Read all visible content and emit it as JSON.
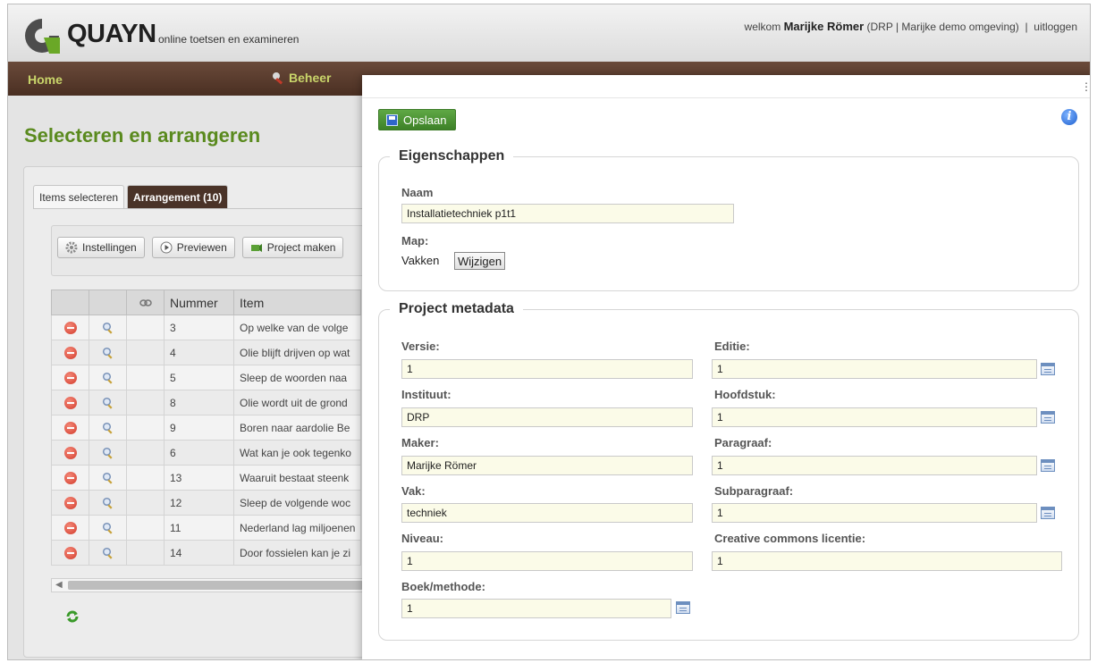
{
  "header": {
    "brand": "QUAYN",
    "tagline": "online toetsen en examineren",
    "welcome_prefix": "welkom",
    "user_name": "Marijke Römer",
    "context": "(DRP | Marijke demo omgeving)",
    "separator": "|",
    "logout": "uitloggen"
  },
  "nav": {
    "home": "Home",
    "beheer": "Beheer"
  },
  "page_title": "Selecteren en arrangeren",
  "tabs": [
    {
      "label": "Items selecteren"
    },
    {
      "label": "Arrangement (10)"
    }
  ],
  "toolbar": {
    "instellingen": "Instellingen",
    "previewen": "Previewen",
    "project_maken": "Project maken"
  },
  "table": {
    "headers": {
      "nummer": "Nummer",
      "item": "Item"
    },
    "rows": [
      {
        "nummer": "3",
        "item": "Op welke van de volge"
      },
      {
        "nummer": "4",
        "item": "Olie blijft drijven op wat"
      },
      {
        "nummer": "5",
        "item": "Sleep de woorden naa"
      },
      {
        "nummer": "8",
        "item": "Olie wordt uit de grond"
      },
      {
        "nummer": "9",
        "item": "Boren naar aardolie Be"
      },
      {
        "nummer": "6",
        "item": "Wat kan je ook tegenko"
      },
      {
        "nummer": "13",
        "item": "Waaruit bestaat steenk"
      },
      {
        "nummer": "12",
        "item": "Sleep de volgende woc"
      },
      {
        "nummer": "11",
        "item": "Nederland lag miljoenen"
      },
      {
        "nummer": "14",
        "item": "Door fossielen kan je zi"
      }
    ]
  },
  "dialog": {
    "save": "Opslaan",
    "eigenschappen": {
      "legend": "Eigenschappen",
      "naam_label": "Naam",
      "naam_value": "Installatietechniek p1t1",
      "map_label": "Map:",
      "map_value": "Vakken",
      "wijzigen": "Wijzigen"
    },
    "metadata": {
      "legend": "Project metadata",
      "versie_label": "Versie:",
      "versie_value": "1",
      "editie_label": "Editie:",
      "editie_value": "1",
      "instituut_label": "Instituut:",
      "instituut_value": "DRP",
      "hoofdstuk_label": "Hoofdstuk:",
      "hoofdstuk_value": "1",
      "maker_label": "Maker:",
      "maker_value": "Marijke Römer",
      "paragraaf_label": "Paragraaf:",
      "paragraaf_value": "1",
      "vak_label": "Vak:",
      "vak_value": "techniek",
      "subparagraaf_label": "Subparagraaf:",
      "subparagraaf_value": "1",
      "niveau_label": "Niveau:",
      "niveau_value": "1",
      "cc_label": "Creative commons licentie:",
      "cc_value": "1",
      "boek_label": "Boek/methode:",
      "boek_value": "1"
    }
  },
  "colors": {
    "brand_green": "#5a8a1e",
    "nav_brown": "#4a2f22",
    "nav_text": "#c9d56a",
    "input_bg": "#fbfbe8",
    "save_green": "#4a922f"
  }
}
